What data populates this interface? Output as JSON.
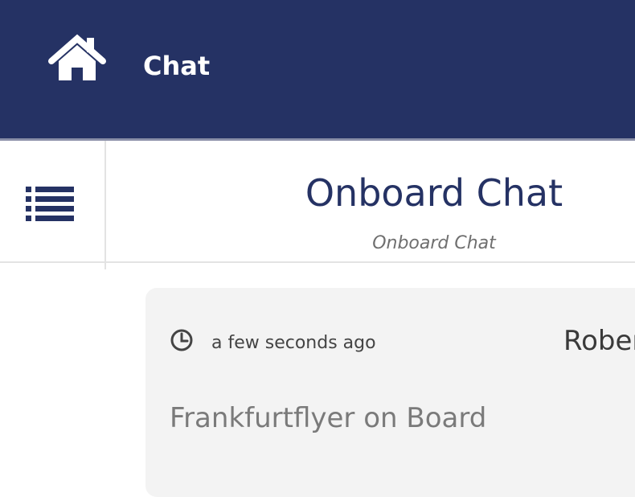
{
  "header": {
    "title": "Chat",
    "home_icon": "home-icon",
    "background_color": "#253264"
  },
  "subheader": {
    "menu_icon": "list-menu-icon",
    "title": "Onboard Chat",
    "subtitle": "Onboard Chat",
    "title_color": "#253264"
  },
  "messages": [
    {
      "timestamp": "a few seconds ago",
      "author": "Rober",
      "text": "Frankfurtflyer on Board",
      "clock_icon": "clock-icon"
    }
  ]
}
